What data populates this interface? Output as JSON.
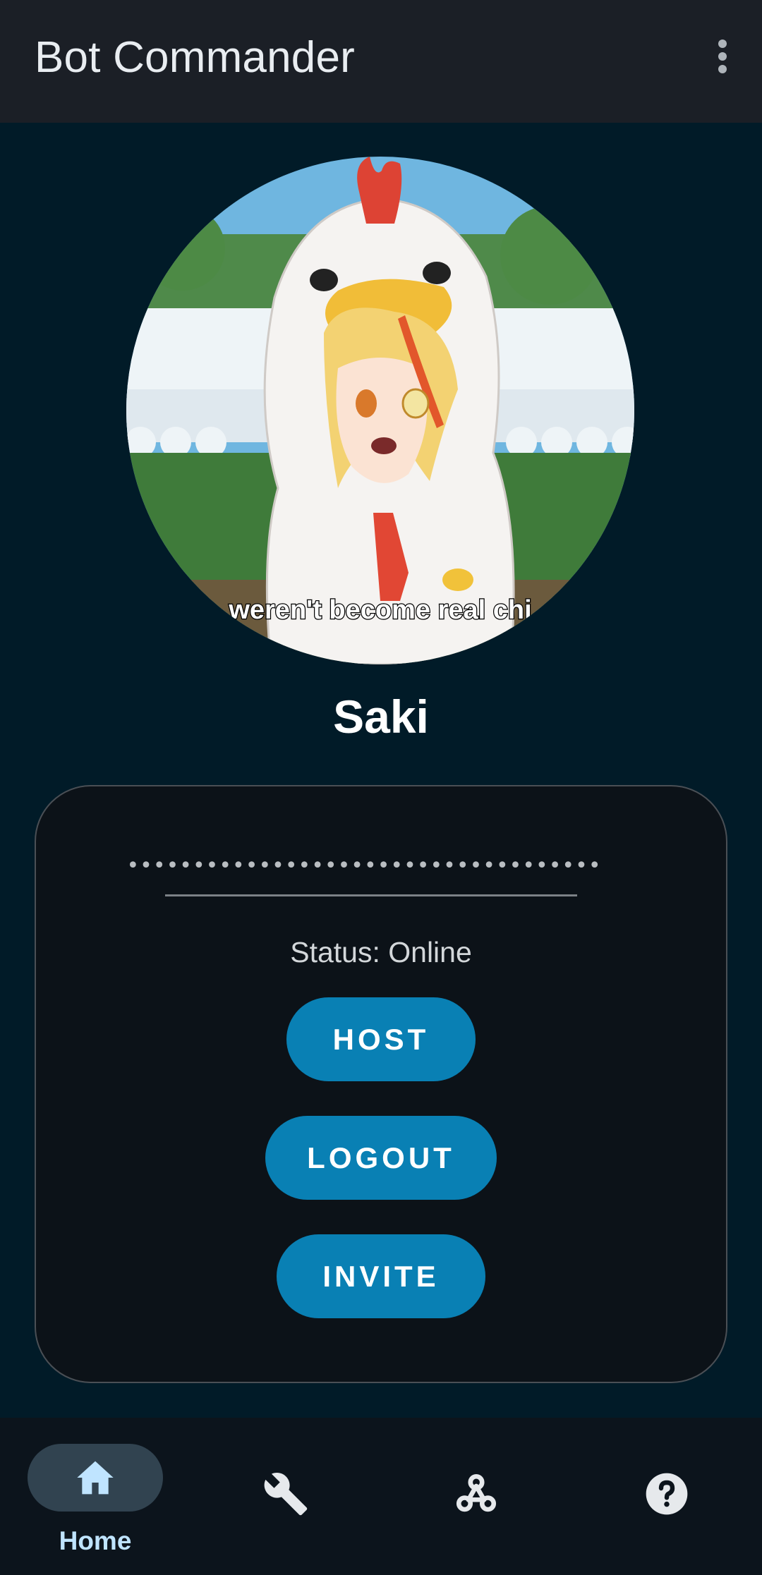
{
  "app_bar": {
    "title": "Bot Commander",
    "menu_icon": "more-vert-icon"
  },
  "profile": {
    "avatar_subtitle_text": "weren't become real chi",
    "name": "Saki"
  },
  "card": {
    "token_masked": "••••••••••••••••••••••••••••••••••••",
    "status": "Status: Online",
    "buttons": {
      "host": "HOST",
      "logout": "LOGOUT",
      "invite": "INVITE"
    }
  },
  "bottom_nav": {
    "items": [
      {
        "icon": "home-icon",
        "label": "Home",
        "active": true
      },
      {
        "icon": "wrench-icon",
        "label": "",
        "active": false
      },
      {
        "icon": "webhook-icon",
        "label": "",
        "active": false
      },
      {
        "icon": "help-icon",
        "label": "",
        "active": false
      }
    ]
  },
  "colors": {
    "background": "#011b28",
    "app_bar": "#1b1f26",
    "card": "#0c1218",
    "button": "#0980b4",
    "nav_active_pill": "#314350",
    "nav_active_label": "#bfe4ff"
  }
}
